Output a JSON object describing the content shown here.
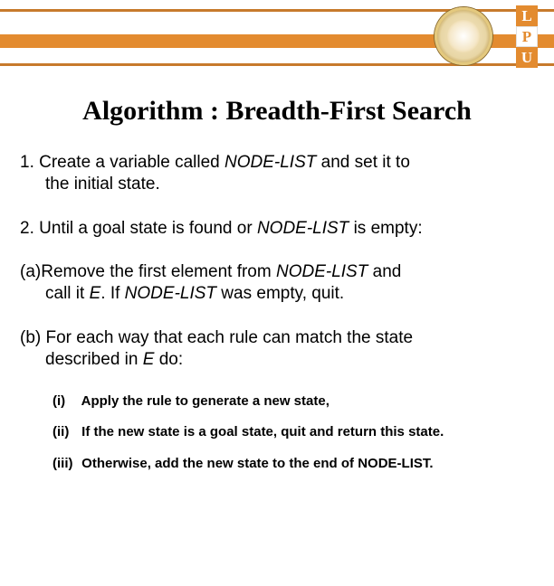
{
  "header": {
    "badge": {
      "l": "L",
      "p": "P",
      "u": "U"
    }
  },
  "title": "Algorithm : Breadth-First Search",
  "step1": {
    "prefix": "1. Create a variable called ",
    "var": "NODE-LIST",
    "mid": " and set it to",
    "cont": "the initial state."
  },
  "step2": {
    "prefix": "2. Until a goal state is found or ",
    "var": "NODE-LIST",
    "suffix": " is empty:"
  },
  "sub_a": {
    "prefix": "(a)Remove the first element from ",
    "var1": "NODE-LIST",
    "mid": " and",
    "cont_pre": "call it ",
    "varE": "E",
    "cont_mid": ". If ",
    "var2": "NODE-LIST",
    "cont_post": " was empty, quit."
  },
  "sub_b": {
    "line1": "(b) For each way that each rule can match the state",
    "cont_pre": "described in ",
    "varE": "E",
    "cont_post": " do:"
  },
  "roman": {
    "i": {
      "num": "(i)",
      "text": "Apply the rule to generate a new state,"
    },
    "ii": {
      "num": "(ii)",
      "text": "If the new state is a goal state, quit and return this state."
    },
    "iii": {
      "num": "(iii)",
      "text": "Otherwise, add the new state to the end of NODE-LIST."
    }
  }
}
